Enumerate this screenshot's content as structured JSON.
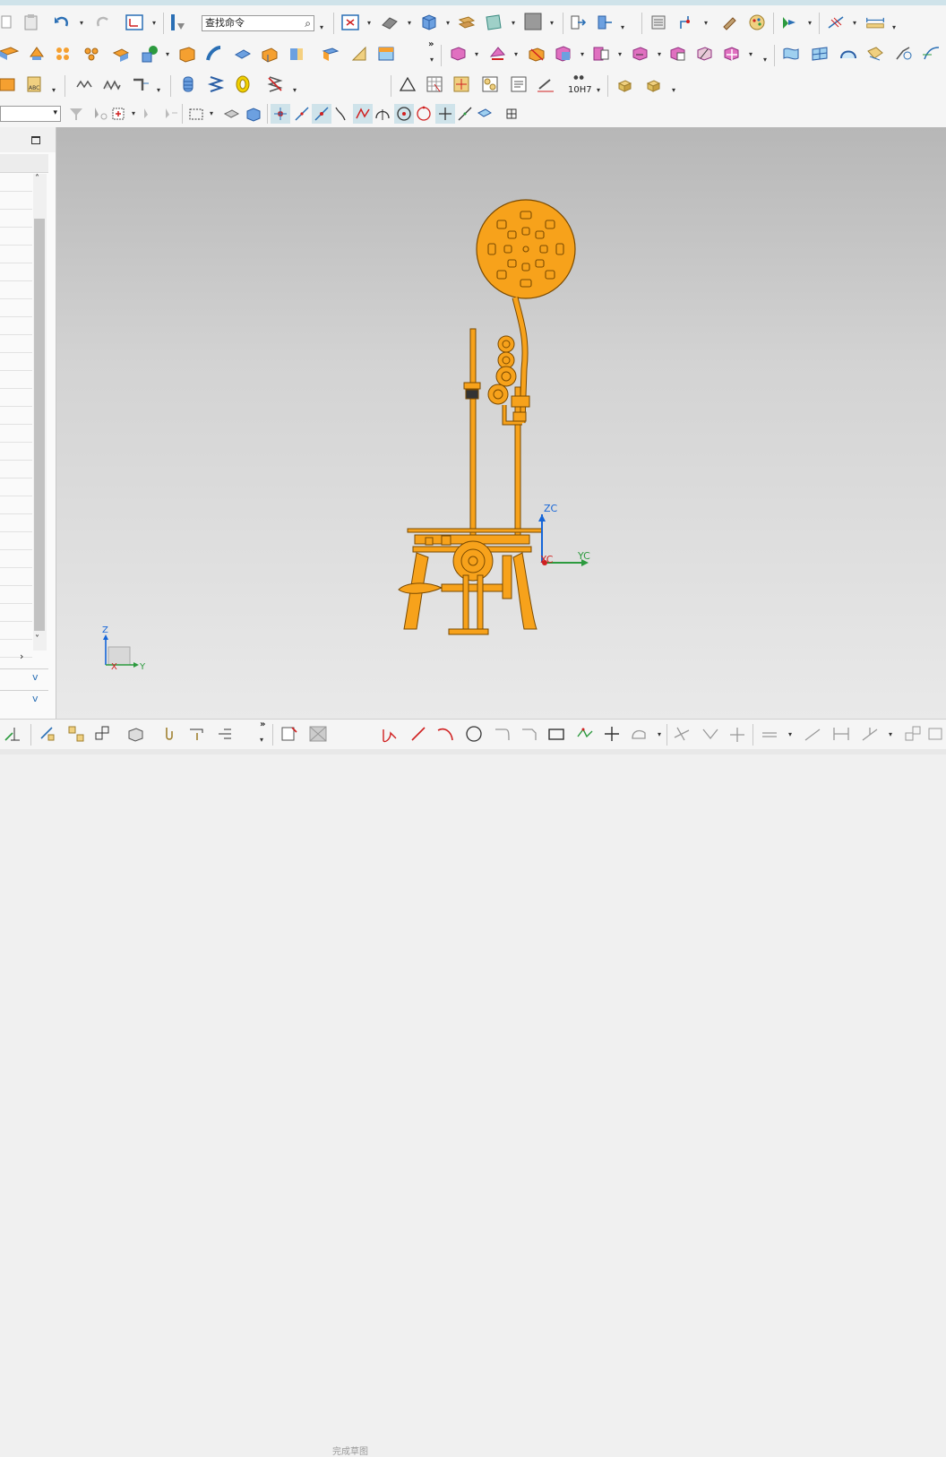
{
  "toolbar": {
    "search_placeholder": "查找命令",
    "more_glyph": "»",
    "dropdown_glyph": "▾",
    "precision_label": "10H7"
  },
  "bottom_toolbar": {
    "finish_sketch_label": "完成草图"
  },
  "viewport": {
    "csys_labels": {
      "zc": "ZC",
      "yc": "YC",
      "xc": "XC"
    },
    "triad_labels": {
      "z": "Z",
      "y": "Y",
      "x": "X"
    },
    "colors": {
      "model": "#f7a21b",
      "zc_axis": "#1565d8",
      "yc_axis": "#2c9a3e",
      "xc_axis": "#d02020"
    }
  },
  "panel": {
    "scroll_up": "˄",
    "scroll_down": "˅",
    "scroll_right": "›",
    "section_chevron": "v"
  },
  "icons": [
    "paste-icon",
    "undo-icon",
    "redo-icon",
    "wcs-icon",
    "info-icon",
    "search-icon",
    "fit-view-icon",
    "render-style-icon",
    "view-orientation-icon",
    "layer-icon",
    "background-icon",
    "move-icon",
    "snap-icon",
    "sketch-icon",
    "dimension-icon"
  ]
}
